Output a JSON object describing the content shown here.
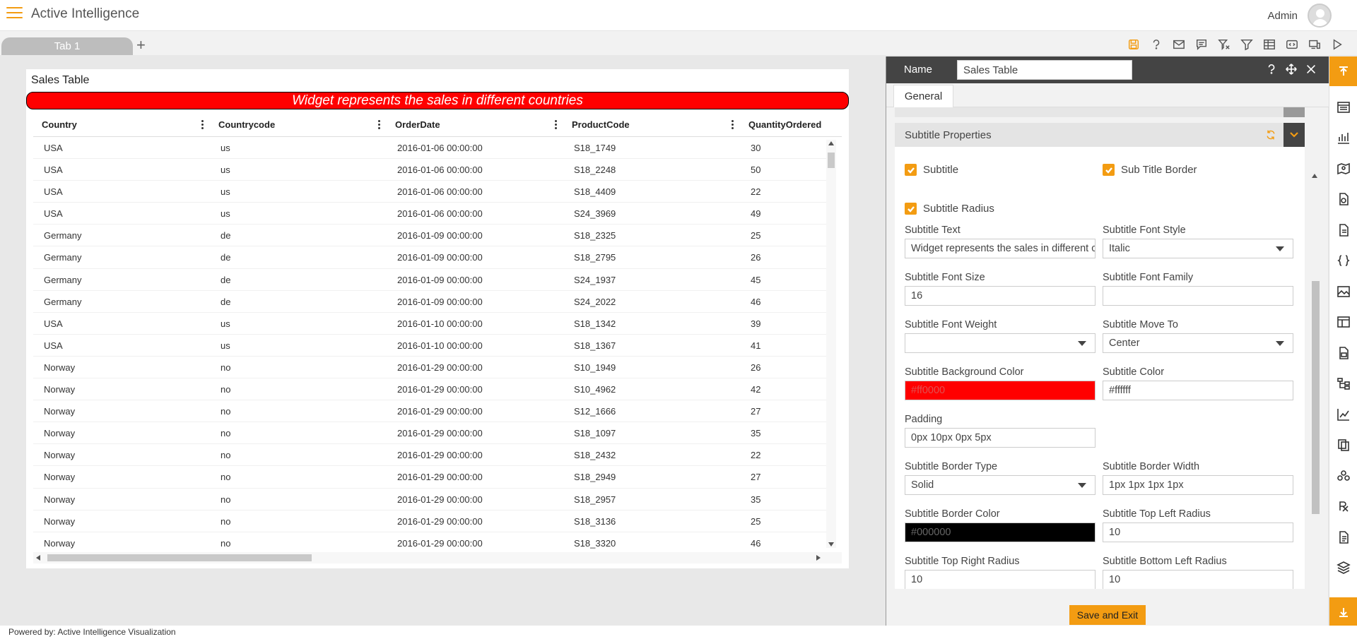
{
  "app": {
    "title": "Active Intelligence",
    "user": "Admin"
  },
  "tabs": [
    {
      "label": "Tab 1"
    }
  ],
  "tab_add": "+",
  "toolbar_icons": [
    "save-icon",
    "help-icon",
    "mail-icon",
    "comment-icon",
    "clear-filter-icon",
    "filter-icon",
    "table-icon",
    "embed-icon",
    "devices-icon",
    "play-icon"
  ],
  "widget": {
    "title": "Sales Table",
    "subtitle": "Widget represents the sales in different countries",
    "columns": [
      "Country",
      "Countrycode",
      "OrderDate",
      "ProductCode",
      "QuantityOrdered"
    ],
    "rows": [
      [
        "USA",
        "us",
        "2016-01-06 00:00:00",
        "S18_1749",
        "30"
      ],
      [
        "USA",
        "us",
        "2016-01-06 00:00:00",
        "S18_2248",
        "50"
      ],
      [
        "USA",
        "us",
        "2016-01-06 00:00:00",
        "S18_4409",
        "22"
      ],
      [
        "USA",
        "us",
        "2016-01-06 00:00:00",
        "S24_3969",
        "49"
      ],
      [
        "Germany",
        "de",
        "2016-01-09 00:00:00",
        "S18_2325",
        "25"
      ],
      [
        "Germany",
        "de",
        "2016-01-09 00:00:00",
        "S18_2795",
        "26"
      ],
      [
        "Germany",
        "de",
        "2016-01-09 00:00:00",
        "S24_1937",
        "45"
      ],
      [
        "Germany",
        "de",
        "2016-01-09 00:00:00",
        "S24_2022",
        "46"
      ],
      [
        "USA",
        "us",
        "2016-01-10 00:00:00",
        "S18_1342",
        "39"
      ],
      [
        "USA",
        "us",
        "2016-01-10 00:00:00",
        "S18_1367",
        "41"
      ],
      [
        "Norway",
        "no",
        "2016-01-29 00:00:00",
        "S10_1949",
        "26"
      ],
      [
        "Norway",
        "no",
        "2016-01-29 00:00:00",
        "S10_4962",
        "42"
      ],
      [
        "Norway",
        "no",
        "2016-01-29 00:00:00",
        "S12_1666",
        "27"
      ],
      [
        "Norway",
        "no",
        "2016-01-29 00:00:00",
        "S18_1097",
        "35"
      ],
      [
        "Norway",
        "no",
        "2016-01-29 00:00:00",
        "S18_2432",
        "22"
      ],
      [
        "Norway",
        "no",
        "2016-01-29 00:00:00",
        "S18_2949",
        "27"
      ],
      [
        "Norway",
        "no",
        "2016-01-29 00:00:00",
        "S18_2957",
        "35"
      ],
      [
        "Norway",
        "no",
        "2016-01-29 00:00:00",
        "S18_3136",
        "25"
      ],
      [
        "Norway",
        "no",
        "2016-01-29 00:00:00",
        "S18_3320",
        "46"
      ]
    ]
  },
  "panel": {
    "name_label": "Name",
    "name_value": "Sales Table",
    "general_tab": "General",
    "section_title": "Subtitle Properties",
    "checkboxes": {
      "subtitle": "Subtitle",
      "subtitle_border": "Sub Title Border",
      "subtitle_radius": "Subtitle Radius"
    },
    "fields": {
      "subtitle_text": {
        "label": "Subtitle Text",
        "value": "Widget represents the sales in different countries"
      },
      "font_style": {
        "label": "Subtitle Font Style",
        "value": "Italic"
      },
      "font_size": {
        "label": "Subtitle Font Size",
        "value": "16"
      },
      "font_family": {
        "label": "Subtitle Font Family",
        "value": ""
      },
      "font_weight": {
        "label": "Subtitle Font Weight",
        "value": ""
      },
      "move_to": {
        "label": "Subtitle Move To",
        "value": "Center"
      },
      "bg_color": {
        "label": "Subtitle Background Color",
        "value": "#ff0000"
      },
      "color": {
        "label": "Subtitle Color",
        "value": "#ffffff"
      },
      "padding": {
        "label": "Padding",
        "value": "0px 10px 0px 5px"
      },
      "border_type": {
        "label": "Subtitle Border Type",
        "value": "Solid"
      },
      "border_width": {
        "label": "Subtitle Border Width",
        "value": "1px 1px 1px 1px"
      },
      "border_color": {
        "label": "Subtitle Border Color",
        "value": "#000000"
      },
      "top_left_radius": {
        "label": "Subtitle Top Left Radius",
        "value": "10"
      },
      "top_right_radius": {
        "label": "Subtitle Top Right Radius",
        "value": "10"
      },
      "bottom_left_radius": {
        "label": "Subtitle Bottom Left Radius",
        "value": "10"
      }
    },
    "save_button": "Save and Exit"
  },
  "colors": {
    "accent": "#f39c12",
    "subtitle_bg": "#ff0000",
    "panel_header": "#444444"
  },
  "footer": "Powered by: Active Intelligence Visualization"
}
